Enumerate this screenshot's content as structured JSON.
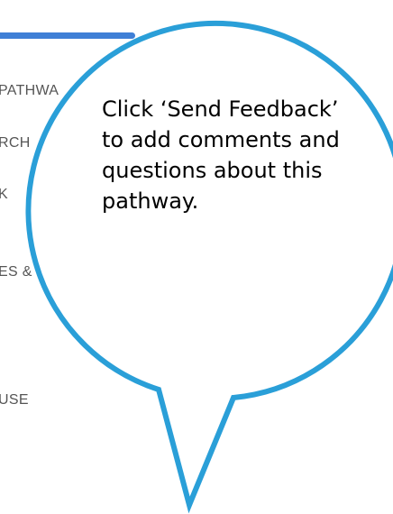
{
  "menu": {
    "items": [
      "PATHWA",
      "RCH",
      "K",
      "ES &",
      "USE"
    ]
  },
  "callout": {
    "text": "Click ‘Send Feedback’ to add comments and questions about this pathway.",
    "fill": "#ffffff",
    "stroke": "#2a9fd8"
  },
  "colors": {
    "menu_bar": "#3f7fd6",
    "menu_text": "#555555"
  }
}
